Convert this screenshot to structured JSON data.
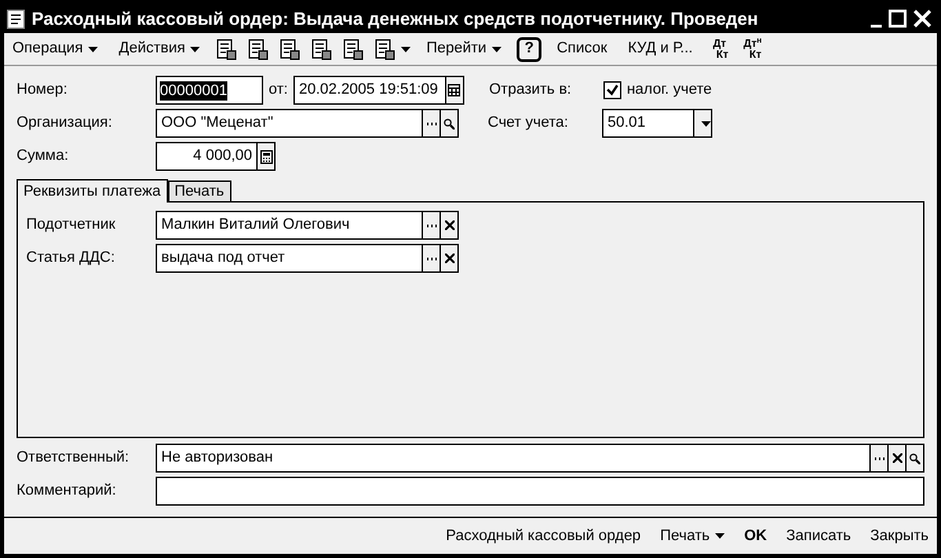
{
  "window": {
    "title": "Расходный кассовый ордер: Выдача денежных средств подотчетнику. Проведен"
  },
  "toolbar": [
    {
      "kind": "menu",
      "label": "Операция"
    },
    {
      "kind": "menu",
      "label": "Действия"
    },
    {
      "kind": "icon"
    },
    {
      "kind": "icon"
    },
    {
      "kind": "icon"
    },
    {
      "kind": "icon"
    },
    {
      "kind": "icon"
    },
    {
      "kind": "iconmenu"
    },
    {
      "kind": "menu",
      "label": "Перейти"
    },
    {
      "kind": "help",
      "label": "?"
    },
    {
      "kind": "text",
      "label": "Список"
    },
    {
      "kind": "text",
      "label": "КУД и Р..."
    },
    {
      "kind": "stack",
      "top": "Дт",
      "bottom": "Кт"
    },
    {
      "kind": "stack",
      "top": "Дт$^{н}$",
      "bottom": "Кт"
    }
  ],
  "header": {
    "number_label": "Номер:",
    "number": "00000001",
    "date_label": "от:",
    "date": "20.02.2005 19:51:09",
    "reflect_label": "Отразить в:",
    "tax_accounting": {
      "label": "налог. учете",
      "checked": true
    },
    "org_label": "Организация:",
    "org": "ООО \"Меценат\"",
    "account_label": "Счет учета:",
    "account": "50.01",
    "sum_label": "Сумма:",
    "sum": "4 000,00"
  },
  "tabs": [
    {
      "label": "Реквизиты платежа",
      "selected": true
    },
    {
      "label": "Печать",
      "selected": false
    }
  ],
  "payment": [
    {
      "label": "Подотчетник",
      "value": "Малкин Виталий Олегович"
    },
    {
      "label": "Статья ДДС:",
      "value": "выдача под отчет"
    }
  ],
  "responsible": {
    "label": "Ответственный:",
    "value": "Не авторизован"
  },
  "comment": {
    "label": "Комментарий:"
  },
  "footer": [
    {
      "kind": "text",
      "label": "Расходный кассовый ордер"
    },
    {
      "kind": "menu",
      "label": "Печать"
    },
    {
      "kind": "bold",
      "label": "OK"
    },
    {
      "kind": "text",
      "label": "Записать"
    },
    {
      "kind": "text",
      "label": "Закрыть"
    }
  ]
}
